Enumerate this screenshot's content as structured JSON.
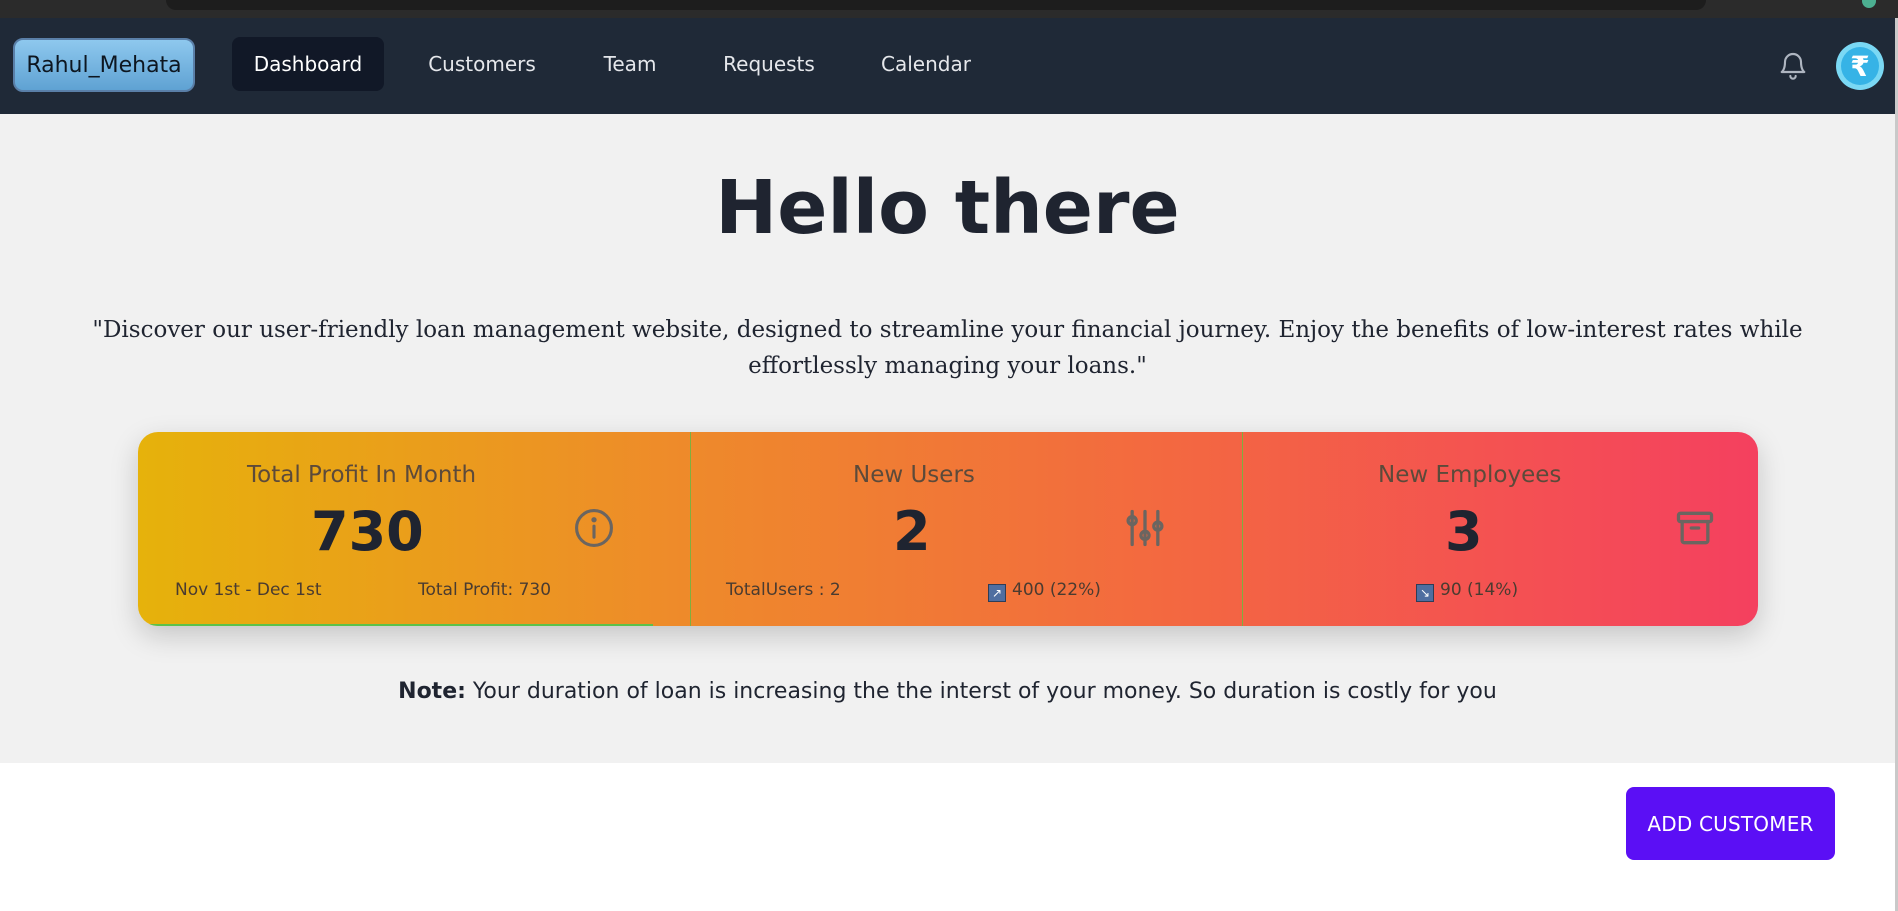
{
  "navbar": {
    "brand": "Rahul_Mehata",
    "items": [
      {
        "label": "Dashboard",
        "active": true
      },
      {
        "label": "Customers",
        "active": false
      },
      {
        "label": "Team",
        "active": false
      },
      {
        "label": "Requests",
        "active": false
      },
      {
        "label": "Calendar",
        "active": false
      }
    ],
    "notification_icon": "bell-icon",
    "avatar_glyph": "₹"
  },
  "hero": {
    "title": "Hello there",
    "quote": "\"Discover our user-friendly loan management website, designed to streamline your financial journey. Enjoy the benefits of low-interest rates while effortlessly managing your loans.\""
  },
  "stats": [
    {
      "title": "Total Profit In Month",
      "value": "730",
      "desc_left": "Nov 1st - Dec 1st",
      "desc_right": "Total Profit: 730",
      "icon": "info-icon"
    },
    {
      "title": "New Users",
      "value": "2",
      "desc_left": "TotalUsers : 2",
      "desc_right": "400 (22%)",
      "trend": "up",
      "trend_glyph": "↗",
      "icon": "sliders-icon"
    },
    {
      "title": "New Employees",
      "value": "3",
      "desc_right": "90 (14%)",
      "trend": "down",
      "trend_glyph": "↘",
      "icon": "archive-icon"
    }
  ],
  "note": {
    "label": "Note:",
    "text": " Your duration of loan is increasing the the interst of your money. So duration is costly for you"
  },
  "actions": {
    "add_customer": "ADD CUSTOMER"
  },
  "colors": {
    "navbar": "#1f2937",
    "accent_button": "#5b0ff5",
    "gradient_start": "#e6b20b",
    "gradient_end": "#f4405f"
  }
}
